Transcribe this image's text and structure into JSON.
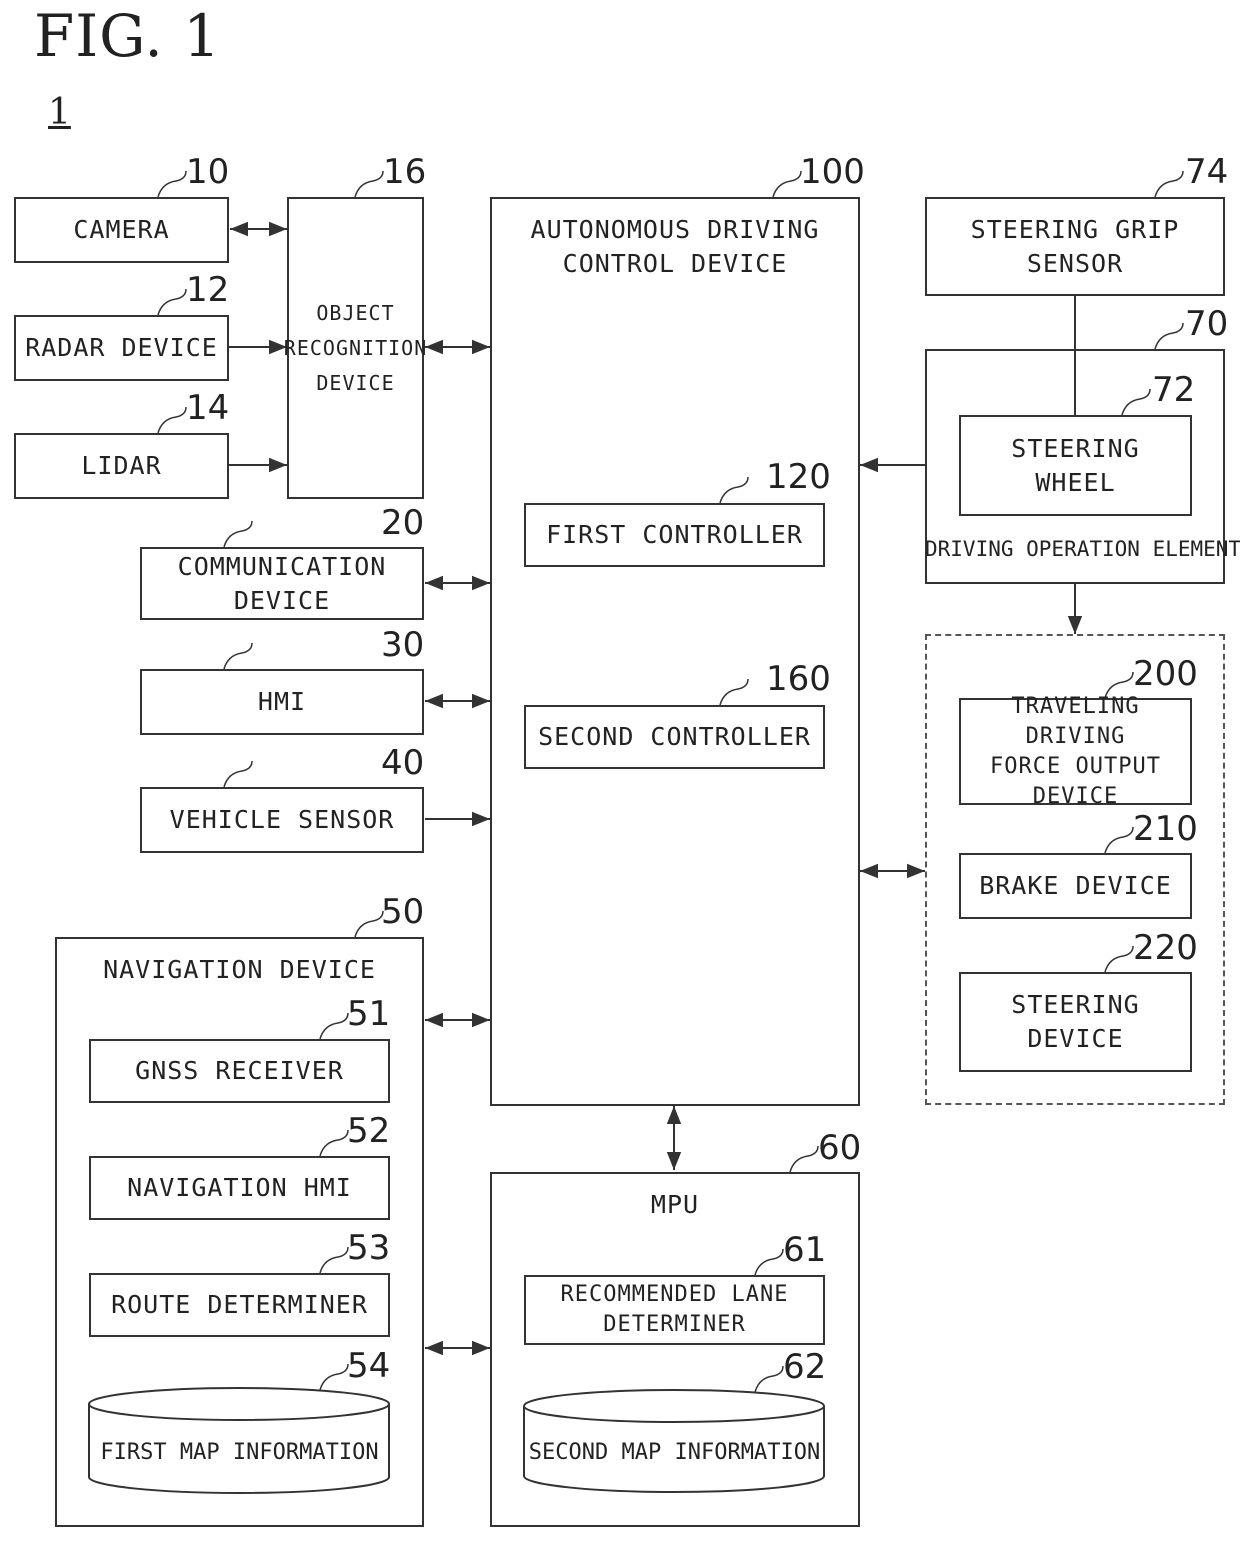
{
  "figure": {
    "title": "FIG. 1",
    "system_ref": "1"
  },
  "components": {
    "camera": {
      "label": "CAMERA",
      "ref": "10"
    },
    "radar": {
      "label": "RADAR DEVICE",
      "ref": "12"
    },
    "lidar": {
      "label": "LIDAR",
      "ref": "14"
    },
    "object_recognition": {
      "label": "OBJECT\nRECOGNITION\nDEVICE",
      "ref": "16"
    },
    "communication": {
      "label": "COMMUNICATION\nDEVICE",
      "ref": "20"
    },
    "hmi": {
      "label": "HMI",
      "ref": "30"
    },
    "vehicle_sensor": {
      "label": "VEHICLE SENSOR",
      "ref": "40"
    },
    "navigation": {
      "label": "NAVIGATION DEVICE",
      "ref": "50"
    },
    "gnss": {
      "label": "GNSS RECEIVER",
      "ref": "51"
    },
    "nav_hmi": {
      "label": "NAVIGATION HMI",
      "ref": "52"
    },
    "route": {
      "label": "ROUTE DETERMINER",
      "ref": "53"
    },
    "first_map": {
      "label": "FIRST MAP INFORMATION",
      "ref": "54"
    },
    "mpu": {
      "label": "MPU",
      "ref": "60"
    },
    "lane": {
      "label": "RECOMMENDED LANE\nDETERMINER",
      "ref": "61"
    },
    "second_map": {
      "label": "SECOND MAP INFORMATION",
      "ref": "62"
    },
    "driving_op": {
      "label": "DRIVING OPERATION ELEMENT",
      "ref": "70"
    },
    "steering_wheel": {
      "label": "STEERING\nWHEEL",
      "ref": "72"
    },
    "grip_sensor": {
      "label": "STEERING GRIP\nSENSOR",
      "ref": "74"
    },
    "adcd": {
      "label": "AUTONOMOUS DRIVING\nCONTROL DEVICE",
      "ref": "100"
    },
    "first_controller": {
      "label": "FIRST CONTROLLER",
      "ref": "120"
    },
    "second_controller": {
      "label": "SECOND CONTROLLER",
      "ref": "160"
    },
    "traveling_force": {
      "label": "TRAVELING DRIVING\nFORCE OUTPUT\nDEVICE",
      "ref": "200"
    },
    "brake": {
      "label": "BRAKE DEVICE",
      "ref": "210"
    },
    "steering_device": {
      "label": "STEERING\nDEVICE",
      "ref": "220"
    }
  },
  "connections": [
    {
      "from": "camera",
      "to": "object_recognition",
      "type": "bidirectional"
    },
    {
      "from": "radar",
      "to": "object_recognition",
      "type": "directed"
    },
    {
      "from": "lidar",
      "to": "object_recognition",
      "type": "directed"
    },
    {
      "from": "object_recognition",
      "to": "adcd",
      "type": "bidirectional"
    },
    {
      "from": "communication",
      "to": "adcd",
      "type": "bidirectional"
    },
    {
      "from": "hmi",
      "to": "adcd",
      "type": "bidirectional"
    },
    {
      "from": "vehicle_sensor",
      "to": "adcd",
      "type": "directed"
    },
    {
      "from": "navigation",
      "to": "adcd",
      "type": "bidirectional"
    },
    {
      "from": "navigation",
      "to": "mpu",
      "type": "bidirectional"
    },
    {
      "from": "adcd",
      "to": "mpu",
      "type": "bidirectional"
    },
    {
      "from": "grip_sensor",
      "to": "steering_wheel",
      "type": "line"
    },
    {
      "from": "driving_op",
      "to": "adcd",
      "type": "directed"
    },
    {
      "from": "driving_op",
      "to": "output_devices",
      "type": "directed"
    },
    {
      "from": "adcd",
      "to": "output_devices",
      "type": "bidirectional"
    }
  ]
}
